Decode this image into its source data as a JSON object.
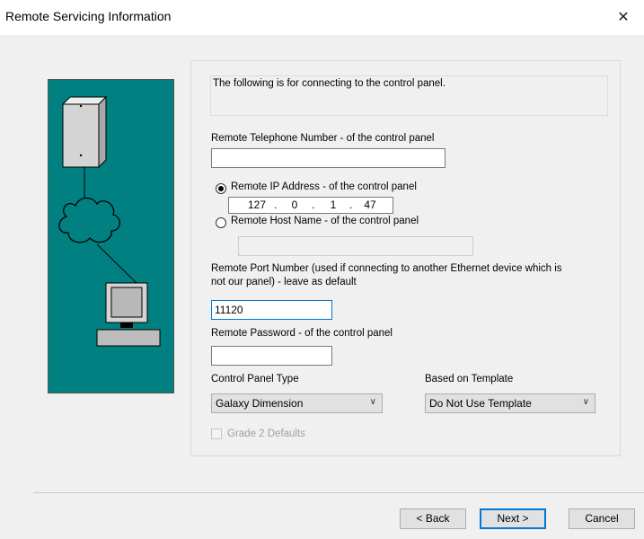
{
  "window": {
    "title": "Remote Servicing Information",
    "close_glyph": "✕"
  },
  "info_text": "The following is for connecting to the control panel.",
  "phone": {
    "label": "Remote Telephone Number - of the control panel",
    "value": ""
  },
  "ip": {
    "label": "Remote IP Address - of the control panel",
    "selected": true,
    "octets": [
      "127",
      "0",
      "1",
      "47"
    ]
  },
  "host": {
    "label": "Remote Host Name  - of the control panel",
    "selected": false,
    "value": ""
  },
  "port": {
    "label_line1": "Remote Port Number (used if connecting to another Ethernet device which is",
    "label_line2": "not our panel) - leave as default",
    "value": "11120"
  },
  "password": {
    "label": "Remote Password - of the control panel",
    "value": ""
  },
  "panel_type": {
    "label": "Control Panel Type",
    "selected": "Galaxy Dimension"
  },
  "template": {
    "label": "Based on Template",
    "selected": "Do Not Use Template"
  },
  "grade2": {
    "label": "Grade 2 Defaults",
    "checked": false,
    "enabled": false
  },
  "buttons": {
    "back": "< Back",
    "next": "Next >",
    "cancel": "Cancel"
  },
  "icons": [
    "computer-tower-icon",
    "network-cloud-icon",
    "monitor-icon",
    "chevron-down-icon",
    "close-icon"
  ],
  "colors": {
    "illustration_bg": "#008080",
    "default_button_border": "#0078d7"
  }
}
